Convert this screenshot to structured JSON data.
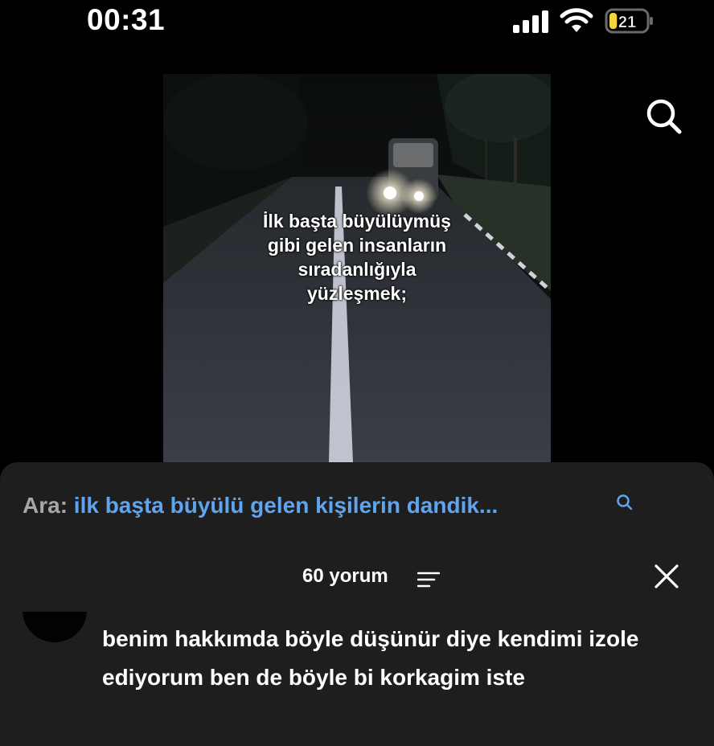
{
  "status_bar": {
    "time": "00:31",
    "battery_level": "21",
    "battery_color": "#f5d53b"
  },
  "video": {
    "overlay_lines": [
      "İlk başta büyülüymüş",
      "gibi gelen insanların",
      "sıradanlığıyla",
      "yüzleşmek;"
    ]
  },
  "search": {
    "prefix": "Ara:",
    "query": "ilk başta büyülü gelen kişilerin dandik...",
    "icon": "search-icon",
    "query_color": "#5fa4ee"
  },
  "comments": {
    "count_label": "60 yorum",
    "items": [
      {
        "text": "benim hakkımda böyle düşünür diye kendimi izole ediyorum ben de böyle bi korkagim iste"
      }
    ]
  }
}
